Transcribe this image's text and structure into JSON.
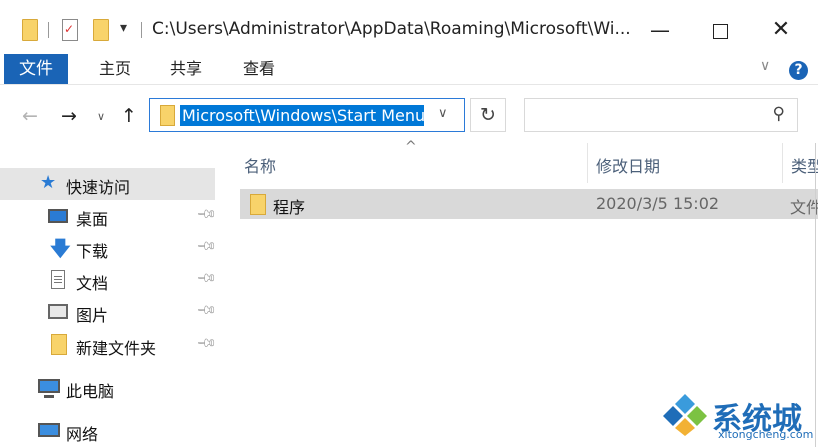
{
  "title_bar": {
    "path": "C:\\Users\\Administrator\\AppData\\Roaming\\Microsoft\\Wi...",
    "minimize": "—",
    "maximize": "",
    "close": "✕"
  },
  "ribbon": {
    "tabs": [
      "文件",
      "主页",
      "共享",
      "查看"
    ],
    "help": "?"
  },
  "address": {
    "path": "Microsoft\\Windows\\Start Menu"
  },
  "nav_pane": {
    "quick_access": "快速访问",
    "items": [
      {
        "label": "桌面",
        "icon": "desktop-icon"
      },
      {
        "label": "下载",
        "icon": "download-icon"
      },
      {
        "label": "文档",
        "icon": "document-icon"
      },
      {
        "label": "图片",
        "icon": "pictures-icon"
      },
      {
        "label": "新建文件夹",
        "icon": "folder-icon"
      }
    ],
    "this_pc": "此电脑",
    "network": "网络"
  },
  "content": {
    "columns": [
      "名称",
      "修改日期",
      "类型"
    ],
    "rows": [
      {
        "name": "程序",
        "modified": "2020/3/5 15:02",
        "type": "文件夹"
      }
    ]
  },
  "watermark": {
    "text": "系统城",
    "url": "xitongcheng.com"
  },
  "colors": {
    "file_tab": "#1a64b6",
    "selection": "#0078d7",
    "row_highlight": "#d9d9d9",
    "folder": "#f8d36a"
  }
}
